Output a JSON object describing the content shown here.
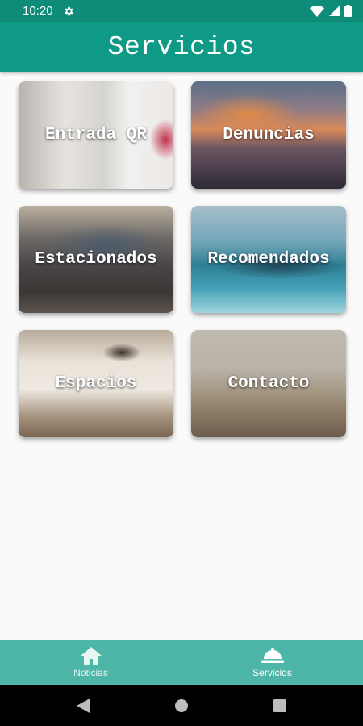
{
  "status_bar": {
    "time": "10:20"
  },
  "app_bar": {
    "title": "Servicios"
  },
  "cards": [
    {
      "label": "Entrada QR"
    },
    {
      "label": "Denuncias"
    },
    {
      "label": "Estacionados"
    },
    {
      "label": "Recomendados"
    },
    {
      "label": "Espacios"
    },
    {
      "label": "Contacto"
    }
  ],
  "bottom_nav": {
    "items": [
      {
        "label": "Noticias",
        "icon": "home-icon"
      },
      {
        "label": "Servicios",
        "icon": "service-bell-icon",
        "active": true
      }
    ]
  },
  "colors": {
    "primary_dark": "#0f8c79",
    "primary": "#0f9a86",
    "bottom_nav": "#4db6a8"
  }
}
